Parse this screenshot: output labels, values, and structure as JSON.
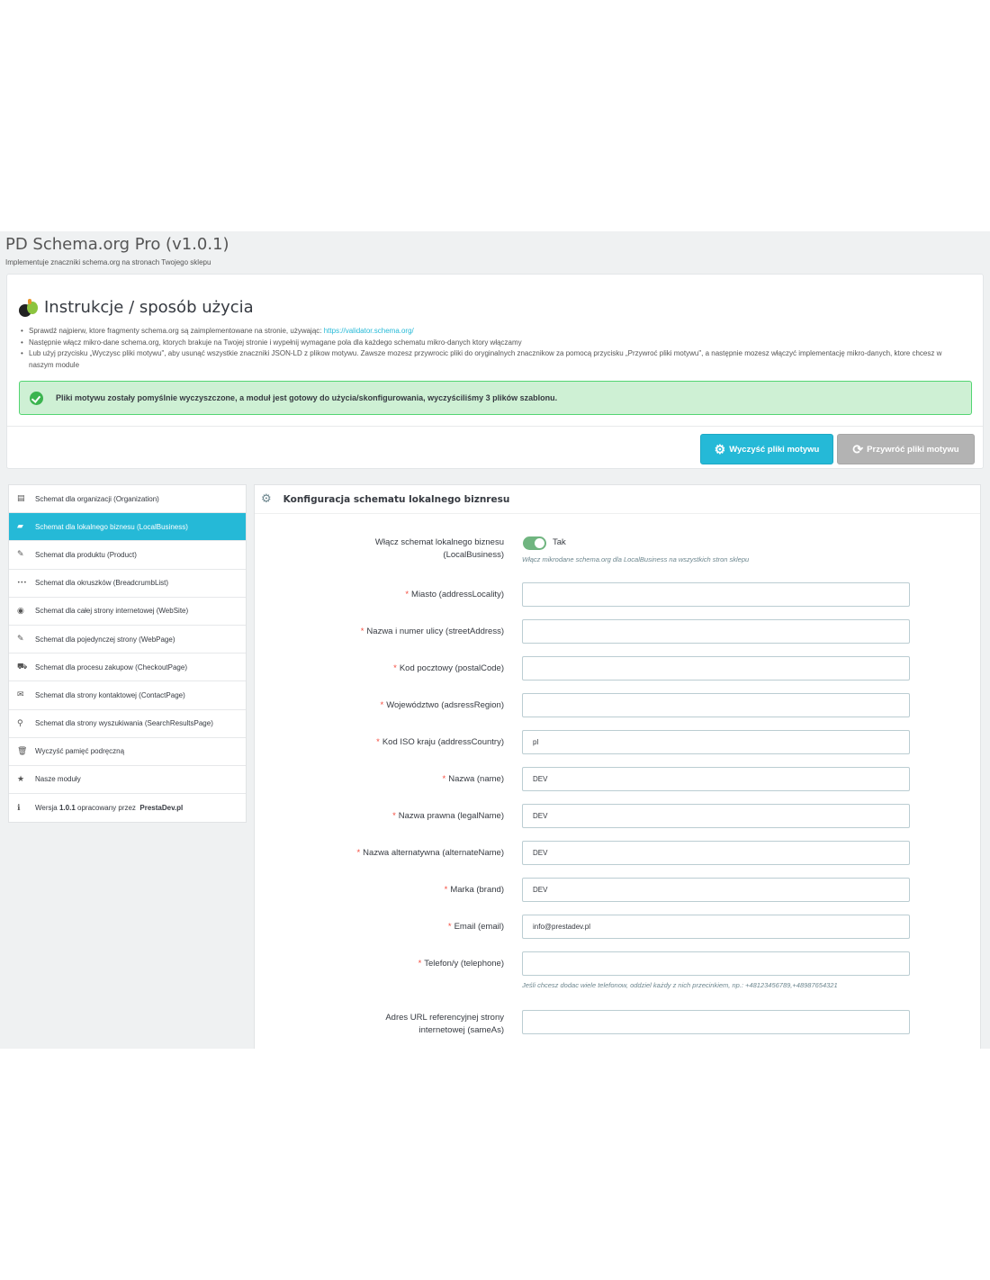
{
  "header": {
    "title": "PD Schema.org Pro (v1.0.1)",
    "subtitle": "Implementuje znaczniki schema.org na stronach Twojego sklepu"
  },
  "instructions": {
    "title": "Instrukcje / sposób użycia",
    "line1_text": "Sprawdź najpierw, ktore fragmenty schema.org są zaimplementowane na stronie, używając: ",
    "line1_link": "https://validator.schema.org/",
    "line2": "Następnie włącz mikro-dane schema.org, ktorych brakuje na Twojej stronie i wypełnij wymagane pola dla każdego schematu mikro-danych ktory włączamy",
    "line3": "Lub użyj przycisku „Wyczysc pliki motywu\", aby usunąć wszystkie znaczniki JSON-LD z plikow motywu. Zawsze mozesz przywrocic pliki do oryginalnych znacznikow za pomocą przycisku „Przywroć pliki motywu\", a następnie mozesz włączyć implementację mikro-danych, ktore chcesz w naszym module",
    "alert": "Pliki motywu zostały pomyślnie wyczyszczone, a moduł jest gotowy do użycia/skonfigurowania, wyczyściliśmy 3 plików szablonu.",
    "btn_clean": "Wyczyść pliki motywu",
    "btn_restore": "Przywróć pliki motywu"
  },
  "sidebar": {
    "items": [
      {
        "icon": "building-icon",
        "glyph": "▤",
        "label": "Schemat dla organizacji (Organization)"
      },
      {
        "icon": "briefcase-icon",
        "glyph": "▰",
        "label": "Schemat dla lokalnego biznesu (LocalBusiness)"
      },
      {
        "icon": "pencil-icon",
        "glyph": "✎",
        "label": "Schemat dla produktu (Product)"
      },
      {
        "icon": "ellipsis-icon",
        "glyph": "•••",
        "label": "Schemat dla okruszków (BreadcrumbList)"
      },
      {
        "icon": "globe-icon",
        "glyph": "◉",
        "label": "Schemat dla całej strony internetowej (WebSite)"
      },
      {
        "icon": "pencil-icon",
        "glyph": "✎",
        "label": "Schemat dla pojedynczej strony (WebPage)"
      },
      {
        "icon": "cart-icon",
        "glyph": "⛟",
        "label": "Schemat dla procesu zakupow (CheckoutPage)"
      },
      {
        "icon": "envelope-icon",
        "glyph": "✉",
        "label": "Schemat dla strony kontaktowej (ContactPage)"
      },
      {
        "icon": "search-icon",
        "glyph": "⚲",
        "label": "Schemat dla strony wyszukiwania (SearchResultsPage)"
      },
      {
        "icon": "trash-icon",
        "glyph": "🗑",
        "label": "Wyczyść pamięć podręczną"
      },
      {
        "icon": "star-icon",
        "glyph": "★",
        "label": "Nasze moduły"
      }
    ],
    "version": {
      "icon": "info-icon",
      "glyph": "ℹ",
      "prefix": "Wersja ",
      "number": "1.0.1",
      "middle": " opracowany przez ",
      "author": "PrestaDev.pl"
    }
  },
  "config": {
    "title": "Konfiguracja schematu lokalnego biznresu",
    "enable_label_1": "Włącz schemat lokalnego biznesu",
    "enable_label_2": "(LocalBusiness)",
    "enable_value": "Tak",
    "enable_help": "Włącz mikrodane schema.org dla LocalBusiness na wszystkich stron sklepu",
    "fields": [
      {
        "label": "Miasto (addressLocality)",
        "value": ""
      },
      {
        "label": "Nazwa i numer ulicy (streetAddress)",
        "value": ""
      },
      {
        "label": "Kod pocztowy (postalCode)",
        "value": ""
      },
      {
        "label": "Województwo (adsressRegion)",
        "value": ""
      },
      {
        "label": "Kod ISO kraju (addressCountry)",
        "value": "pl"
      },
      {
        "label": "Nazwa (name)",
        "value": "DEV"
      },
      {
        "label": "Nazwa prawna (legalName)",
        "value": "DEV"
      },
      {
        "label": "Nazwa alternatywna (alternateName)",
        "value": "DEV"
      },
      {
        "label": "Marka (brand)",
        "value": "DEV"
      },
      {
        "label": "Email (email)",
        "value": "info@prestadev.pl"
      },
      {
        "label": "Telefon/y (telephone)",
        "value": ""
      }
    ],
    "phone_help": "Jeśli chcesz dodac wiele telefonow, oddziel każdy z nich przecinkiem, np.: +48123456789,+48987654321",
    "sameas_label_1": "Adres URL referencyjnej strony",
    "sameas_label_2": "internetowej (sameAs)",
    "sameas_value": ""
  }
}
